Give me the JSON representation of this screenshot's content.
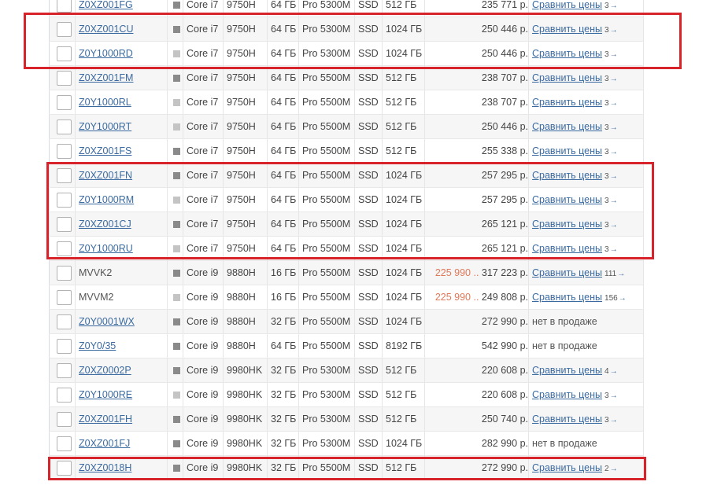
{
  "rows": [
    {
      "sku": "Z0XZ001FG",
      "link": true,
      "dot": "#8a8a8a",
      "cpu": "Core i7",
      "model": "9750H",
      "ram": "64 ГБ",
      "gpu": "Pro 5300M",
      "stype": "SSD",
      "ssd": "512 ГБ",
      "range": "",
      "price": "235 771 р.",
      "cmp": "Сравнить цены",
      "count": "3",
      "arrow": "→"
    },
    {
      "sku": "Z0XZ001CU",
      "link": true,
      "dot": "#8a8a8a",
      "cpu": "Core i7",
      "model": "9750H",
      "ram": "64 ГБ",
      "gpu": "Pro 5300M",
      "stype": "SSD",
      "ssd": "1024 ГБ",
      "range": "",
      "price": "250 446 р.",
      "cmp": "Сравнить цены",
      "count": "3",
      "arrow": "→"
    },
    {
      "sku": "Z0Y1000RD",
      "link": true,
      "dot": "#c4c4c4",
      "cpu": "Core i7",
      "model": "9750H",
      "ram": "64 ГБ",
      "gpu": "Pro 5300M",
      "stype": "SSD",
      "ssd": "1024 ГБ",
      "range": "",
      "price": "250 446 р.",
      "cmp": "Сравнить цены",
      "count": "3",
      "arrow": "→"
    },
    {
      "sku": "Z0XZ001FM",
      "link": true,
      "dot": "#8a8a8a",
      "cpu": "Core i7",
      "model": "9750H",
      "ram": "64 ГБ",
      "gpu": "Pro 5500M",
      "stype": "SSD",
      "ssd": "512 ГБ",
      "range": "",
      "price": "238 707 р.",
      "cmp": "Сравнить цены",
      "count": "3",
      "arrow": "→"
    },
    {
      "sku": "Z0Y1000RL",
      "link": true,
      "dot": "#c4c4c4",
      "cpu": "Core i7",
      "model": "9750H",
      "ram": "64 ГБ",
      "gpu": "Pro 5500M",
      "stype": "SSD",
      "ssd": "512 ГБ",
      "range": "",
      "price": "238 707 р.",
      "cmp": "Сравнить цены",
      "count": "3",
      "arrow": "→"
    },
    {
      "sku": "Z0Y1000RT",
      "link": true,
      "dot": "#c4c4c4",
      "cpu": "Core i7",
      "model": "9750H",
      "ram": "64 ГБ",
      "gpu": "Pro 5500M",
      "stype": "SSD",
      "ssd": "512 ГБ",
      "range": "",
      "price": "250 446 р.",
      "cmp": "Сравнить цены",
      "count": "3",
      "arrow": "→"
    },
    {
      "sku": "Z0XZ001FS",
      "link": true,
      "dot": "#8a8a8a",
      "cpu": "Core i7",
      "model": "9750H",
      "ram": "64 ГБ",
      "gpu": "Pro 5500M",
      "stype": "SSD",
      "ssd": "512 ГБ",
      "range": "",
      "price": "255 338 р.",
      "cmp": "Сравнить цены",
      "count": "3",
      "arrow": "→"
    },
    {
      "sku": "Z0XZ001FN",
      "link": true,
      "dot": "#8a8a8a",
      "cpu": "Core i7",
      "model": "9750H",
      "ram": "64 ГБ",
      "gpu": "Pro 5500M",
      "stype": "SSD",
      "ssd": "1024 ГБ",
      "range": "",
      "price": "257 295 р.",
      "cmp": "Сравнить цены",
      "count": "3",
      "arrow": "→"
    },
    {
      "sku": "Z0Y1000RM",
      "link": true,
      "dot": "#c4c4c4",
      "cpu": "Core i7",
      "model": "9750H",
      "ram": "64 ГБ",
      "gpu": "Pro 5500M",
      "stype": "SSD",
      "ssd": "1024 ГБ",
      "range": "",
      "price": "257 295 р.",
      "cmp": "Сравнить цены",
      "count": "3",
      "arrow": "→"
    },
    {
      "sku": "Z0XZ001CJ",
      "link": true,
      "dot": "#8a8a8a",
      "cpu": "Core i7",
      "model": "9750H",
      "ram": "64 ГБ",
      "gpu": "Pro 5500M",
      "stype": "SSD",
      "ssd": "1024 ГБ",
      "range": "",
      "price": "265 121 р.",
      "cmp": "Сравнить цены",
      "count": "3",
      "arrow": "→"
    },
    {
      "sku": "Z0Y1000RU",
      "link": true,
      "dot": "#c4c4c4",
      "cpu": "Core i7",
      "model": "9750H",
      "ram": "64 ГБ",
      "gpu": "Pro 5500M",
      "stype": "SSD",
      "ssd": "1024 ГБ",
      "range": "",
      "price": "265 121 р.",
      "cmp": "Сравнить цены",
      "count": "3",
      "arrow": "→"
    },
    {
      "sku": "MVVK2",
      "link": false,
      "dot": "#8a8a8a",
      "cpu": "Core i9",
      "model": "9880H",
      "ram": "16 ГБ",
      "gpu": "Pro 5500M",
      "stype": "SSD",
      "ssd": "1024 ГБ",
      "range": "225 990 ..",
      "price": "317 223 р.",
      "cmp": "Сравнить цены",
      "count": "111",
      "arrow": "→"
    },
    {
      "sku": "MVVM2",
      "link": false,
      "dot": "#c4c4c4",
      "cpu": "Core i9",
      "model": "9880H",
      "ram": "16 ГБ",
      "gpu": "Pro 5500M",
      "stype": "SSD",
      "ssd": "1024 ГБ",
      "range": "225 990 ..",
      "price": "249 808 р.",
      "cmp": "Сравнить цены",
      "count": "156",
      "arrow": "→"
    },
    {
      "sku": "Z0Y0001WX",
      "link": true,
      "dot": "#8a8a8a",
      "cpu": "Core i9",
      "model": "9880H",
      "ram": "32 ГБ",
      "gpu": "Pro 5500M",
      "stype": "SSD",
      "ssd": "1024 ГБ",
      "range": "",
      "price": "272 990 р.",
      "cmp": "нет в продаже",
      "count": "",
      "arrow": ""
    },
    {
      "sku": "Z0Y0/35",
      "link": true,
      "dot": "#8a8a8a",
      "cpu": "Core i9",
      "model": "9880H",
      "ram": "64 ГБ",
      "gpu": "Pro 5500M",
      "stype": "SSD",
      "ssd": "8192 ГБ",
      "range": "",
      "price": "542 990 р.",
      "cmp": "нет в продаже",
      "count": "",
      "arrow": ""
    },
    {
      "sku": "Z0XZ0002P",
      "link": true,
      "dot": "#8a8a8a",
      "cpu": "Core i9",
      "model": "9980HK",
      "ram": "32 ГБ",
      "gpu": "Pro 5300M",
      "stype": "SSD",
      "ssd": "512 ГБ",
      "range": "",
      "price": "220 608 р.",
      "cmp": "Сравнить цены",
      "count": "4",
      "arrow": "→"
    },
    {
      "sku": "Z0Y1000RE",
      "link": true,
      "dot": "#c4c4c4",
      "cpu": "Core i9",
      "model": "9980HK",
      "ram": "32 ГБ",
      "gpu": "Pro 5300M",
      "stype": "SSD",
      "ssd": "512 ГБ",
      "range": "",
      "price": "220 608 р.",
      "cmp": "Сравнить цены",
      "count": "3",
      "arrow": "→"
    },
    {
      "sku": "Z0XZ001FH",
      "link": true,
      "dot": "#8a8a8a",
      "cpu": "Core i9",
      "model": "9980HK",
      "ram": "32 ГБ",
      "gpu": "Pro 5300M",
      "stype": "SSD",
      "ssd": "512 ГБ",
      "range": "",
      "price": "250 740 р.",
      "cmp": "Сравнить цены",
      "count": "3",
      "arrow": "→"
    },
    {
      "sku": "Z0XZ001FJ",
      "link": true,
      "dot": "#8a8a8a",
      "cpu": "Core i9",
      "model": "9980HK",
      "ram": "32 ГБ",
      "gpu": "Pro 5300M",
      "stype": "SSD",
      "ssd": "1024 ГБ",
      "range": "",
      "price": "282 990 р.",
      "cmp": "нет в продаже",
      "count": "",
      "arrow": ""
    },
    {
      "sku": "Z0XZ0018H",
      "link": true,
      "dot": "#8a8a8a",
      "cpu": "Core i9",
      "model": "9980HK",
      "ram": "32 ГБ",
      "gpu": "Pro 5500M",
      "stype": "SSD",
      "ssd": "512 ГБ",
      "range": "",
      "price": "272 990 р.",
      "cmp": "Сравнить цены",
      "count": "2",
      "arrow": "→"
    }
  ]
}
